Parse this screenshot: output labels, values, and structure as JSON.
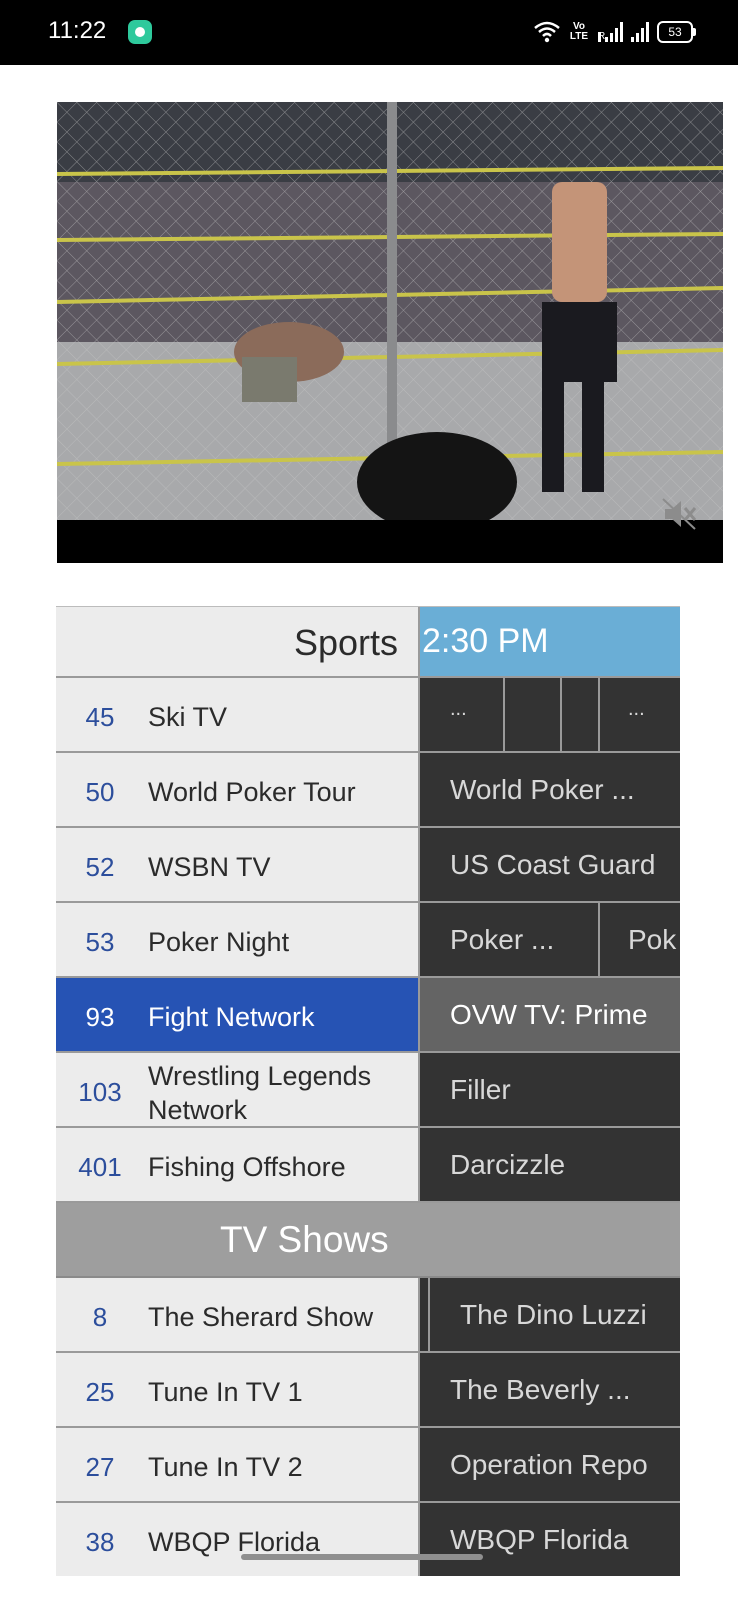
{
  "status_bar": {
    "time": "11:22",
    "battery": "53",
    "volte": "Vo LTE",
    "roaming": "R"
  },
  "video": {
    "mute_icon": "volume-mute-icon"
  },
  "guide": {
    "categories": [
      {
        "title": "Sports",
        "time": "2:30 PM",
        "channels": [
          {
            "number": "45",
            "name": "Ski TV",
            "programs": [
              "...",
              "..."
            ]
          },
          {
            "number": "50",
            "name": "World Poker Tour",
            "programs": [
              "World Poker ..."
            ]
          },
          {
            "number": "52",
            "name": "WSBN TV",
            "programs": [
              "US Coast Guard"
            ]
          },
          {
            "number": "53",
            "name": "Poker Night",
            "programs": [
              "Poker ...",
              "Pok"
            ]
          },
          {
            "number": "93",
            "name": "Fight Network",
            "programs": [
              "OVW TV: Prime"
            ],
            "selected": true
          },
          {
            "number": "103",
            "name": "Wrestling Legends Network",
            "programs": [
              "Filler"
            ]
          },
          {
            "number": "401",
            "name": "Fishing Offshore",
            "programs": [
              "Darcizzle"
            ]
          }
        ]
      },
      {
        "title": "TV Shows",
        "channels": [
          {
            "number": "8",
            "name": "The Sherard Show",
            "programs": [
              "The Dino Luzzi"
            ]
          },
          {
            "number": "25",
            "name": "Tune In TV 1",
            "programs": [
              "The Beverly ..."
            ]
          },
          {
            "number": "27",
            "name": "Tune In TV 2",
            "programs": [
              "Operation Repo"
            ]
          },
          {
            "number": "38",
            "name": "WBQP Florida",
            "programs": [
              "WBQP Florida"
            ]
          }
        ]
      }
    ]
  }
}
